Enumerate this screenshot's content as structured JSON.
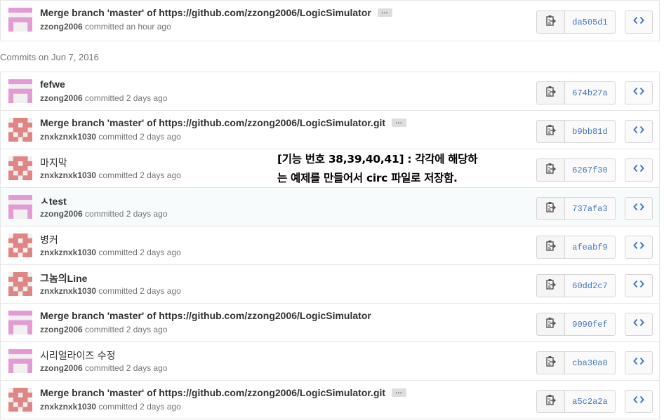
{
  "colors": {
    "avatar_pink": "#e39bd4",
    "avatar_red": "#e08583",
    "sha_link": "#4078c0"
  },
  "icons": {
    "copy": "clippy-icon",
    "browse": "code-icon"
  },
  "top_commit": {
    "message": "Merge branch 'master' of https://github.com/zzong2006/LogicSimulator",
    "author": "zzong2006",
    "committed": "committed an hour ago",
    "sha": "da505d1",
    "avatar": "pink",
    "has_ellipsis": true
  },
  "group": {
    "title": "Commits on Jun 7, 2016",
    "commits": [
      {
        "message": "fefwe",
        "author": "zzong2006",
        "committed": "committed 2 days ago",
        "sha": "674b27a",
        "avatar": "pink",
        "has_ellipsis": false,
        "ko": false
      },
      {
        "message": "Merge branch 'master' of https://github.com/zzong2006/LogicSimulator.git",
        "author": "znxkznxk1030",
        "committed": "committed 2 days ago",
        "sha": "b9bb81d",
        "avatar": "red",
        "has_ellipsis": true,
        "ko": false
      },
      {
        "message": "마지막",
        "author": "znxkznxk1030",
        "committed": "committed 2 days ago",
        "sha": "6267f30",
        "avatar": "red",
        "has_ellipsis": false,
        "ko": true
      },
      {
        "message": "ㅅtest",
        "author": "zzong2006",
        "committed": "committed 2 days ago",
        "sha": "737afa3",
        "avatar": "pink",
        "has_ellipsis": false,
        "ko": false,
        "highlight": true
      },
      {
        "message": "병커",
        "author": "znxkznxk1030",
        "committed": "committed 2 days ago",
        "sha": "afeabf9",
        "avatar": "red",
        "has_ellipsis": false,
        "ko": true
      },
      {
        "message": "그놈의Line",
        "author": "znxkznxk1030",
        "committed": "committed 2 days ago",
        "sha": "60dd2c7",
        "avatar": "red",
        "has_ellipsis": false,
        "ko": false
      },
      {
        "message": "Merge branch 'master' of https://github.com/zzong2006/LogicSimulator",
        "author": "zzong2006",
        "committed": "committed 2 days ago",
        "sha": "9090fef",
        "avatar": "pink",
        "has_ellipsis": false,
        "ko": false
      },
      {
        "message": "시리얼라이즈 수정",
        "author": "zzong2006",
        "committed": "committed 2 days ago",
        "sha": "cba30a8",
        "avatar": "pink",
        "has_ellipsis": false,
        "ko": true
      },
      {
        "message": "Merge branch 'master' of https://github.com/zzong2006/LogicSimulator.git",
        "author": "znxkznxk1030",
        "committed": "committed 2 days ago",
        "sha": "a5c2a2a",
        "avatar": "red",
        "has_ellipsis": true,
        "ko": false
      }
    ]
  },
  "overlay_note": {
    "line1": "[기능 번호 38,39,40,41] : 각각에 해당하",
    "line2": "는 예제를 만들어서 circ 파일로 저장함."
  }
}
